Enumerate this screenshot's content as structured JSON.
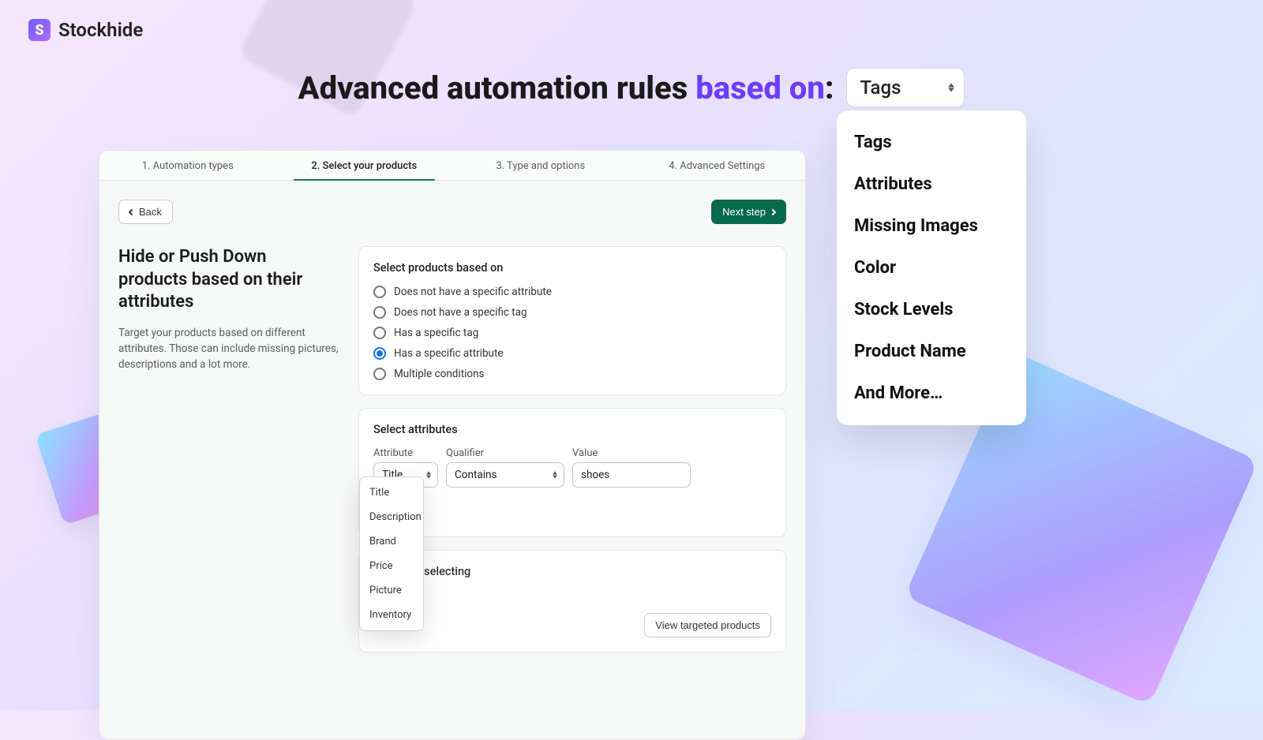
{
  "logo": {
    "text": "Stockhide",
    "mark": "S"
  },
  "heading": {
    "prefix": "Advanced automation rules ",
    "accent": "based on",
    "colon": ":",
    "select_value": "Tags"
  },
  "dropdown_options": [
    "Tags",
    "Attributes",
    "Missing Images",
    "Color",
    "Stock Levels",
    "Product Name",
    "And More…"
  ],
  "stepper": [
    {
      "label": "1. Automation types",
      "active": false
    },
    {
      "label": "2. Select your products",
      "active": true
    },
    {
      "label": "3. Type and options",
      "active": false
    },
    {
      "label": "4. Advanced Settings",
      "active": false
    }
  ],
  "buttons": {
    "back": "Back",
    "next": "Next step",
    "view": "View targeted products"
  },
  "left": {
    "title": "Hide or Push Down products based on their attributes",
    "desc": "Target your products based on different attributes. Those can include missing pictures, descriptions and a lot more."
  },
  "radio_panel": {
    "title": "Select products based on",
    "options": [
      {
        "label": "Does not have a specific attribute",
        "checked": false
      },
      {
        "label": "Does not have a specific tag",
        "checked": false
      },
      {
        "label": "Has a specific tag",
        "checked": false
      },
      {
        "label": "Has a specific attribute",
        "checked": true
      },
      {
        "label": "Multiple conditions",
        "checked": false
      }
    ]
  },
  "attr_panel": {
    "title": "Select attributes",
    "attribute_label": "Attribute",
    "qualifier_label": "Qualifier",
    "value_label": "Value",
    "attribute_value": "Title",
    "qualifier_value": "Contains",
    "value_value": "shoes"
  },
  "attr_options": [
    "Title",
    "Description",
    "Brand",
    "Price",
    "Picture",
    "Inventory"
  ],
  "target_panel": {
    "partial": "rgeting is selecting"
  }
}
